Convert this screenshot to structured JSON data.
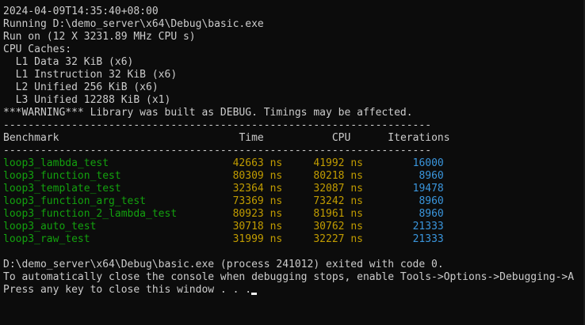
{
  "console": {
    "header_lines": [
      "2024-04-09T14:35:40+08:00",
      "Running D:\\demo_server\\x64\\Debug\\basic.exe",
      "Run on (12 X 3231.89 MHz CPU s)",
      "CPU Caches:",
      "  L1 Data 32 KiB (x6)",
      "  L1 Instruction 32 KiB (x6)",
      "  L2 Unified 256 KiB (x6)",
      "  L3 Unified 12288 KiB (x1)",
      "***WARNING*** Library was built as DEBUG. Timings may be affected."
    ],
    "separator": "---------------------------------------------------------------------",
    "column_headers": {
      "benchmark": "Benchmark",
      "time": "Time",
      "cpu": "CPU",
      "iterations": "Iterations"
    },
    "rows": [
      {
        "name": "loop3_lambda_test",
        "time": "42663",
        "time_unit": "ns",
        "cpu": "41992",
        "cpu_unit": "ns",
        "iterations": "16000"
      },
      {
        "name": "loop3_function_test",
        "time": "80309",
        "time_unit": "ns",
        "cpu": "80218",
        "cpu_unit": "ns",
        "iterations": "8960"
      },
      {
        "name": "loop3_template_test",
        "time": "32364",
        "time_unit": "ns",
        "cpu": "32087",
        "cpu_unit": "ns",
        "iterations": "19478"
      },
      {
        "name": "loop3_function_arg_test",
        "time": "73369",
        "time_unit": "ns",
        "cpu": "73242",
        "cpu_unit": "ns",
        "iterations": "8960"
      },
      {
        "name": "loop3_function_2_lambda_test",
        "time": "80923",
        "time_unit": "ns",
        "cpu": "81961",
        "cpu_unit": "ns",
        "iterations": "8960"
      },
      {
        "name": "loop3_auto_test",
        "time": "30718",
        "time_unit": "ns",
        "cpu": "30762",
        "cpu_unit": "ns",
        "iterations": "21333"
      },
      {
        "name": "loop3_raw_test",
        "time": "31999",
        "time_unit": "ns",
        "cpu": "32227",
        "cpu_unit": "ns",
        "iterations": "21333"
      }
    ],
    "footer_lines": [
      "D:\\demo_server\\x64\\Debug\\basic.exe (process 241012) exited with code 0.",
      "To automatically close the console when debugging stops, enable Tools->Options->Debugging->A",
      "Press any key to close this window . . ."
    ],
    "colors": {
      "background": "#0c0c0c",
      "foreground": "#cccccc",
      "name_color": "#13a10e",
      "value_color": "#c19c00",
      "iterations_color": "#3a96dd"
    }
  }
}
